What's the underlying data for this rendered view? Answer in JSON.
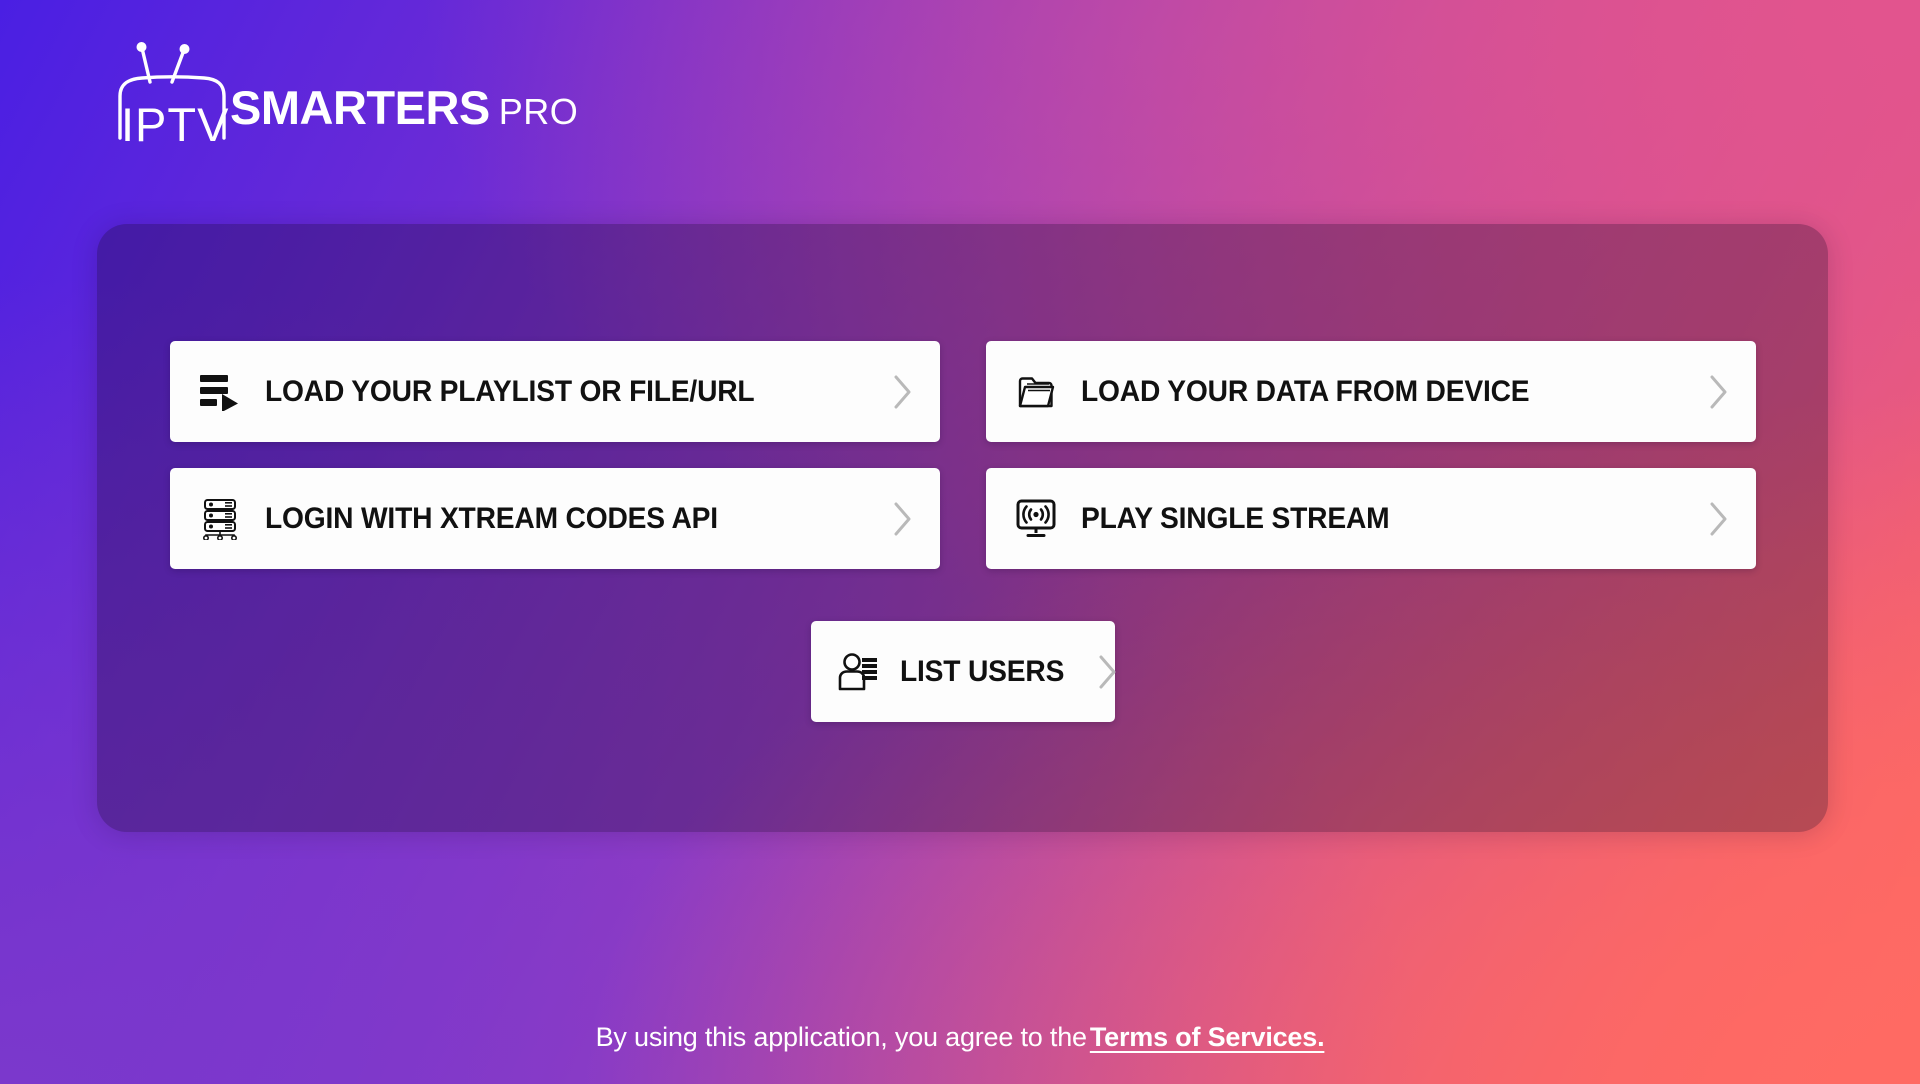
{
  "app": {
    "logo": {
      "icon": "tv-outline-icon",
      "text_light": "IPTV",
      "text_bold": "SMARTERS",
      "text_suffix": "PRO"
    },
    "background": {
      "top_left": "#4A1FE3",
      "top_right": "#D9558A",
      "bottom_left": "#7439C4",
      "bottom_right": "#FC6566"
    },
    "panel": {
      "overlay_color": "rgba(22,6,40,0.30)"
    }
  },
  "menu": {
    "tiles": [
      {
        "id": "load-playlist",
        "label": "LOAD YOUR PLAYLIST OR FILE/URL",
        "icon": "playlist-play-icon",
        "chevron": "chevron-right-icon"
      },
      {
        "id": "load-device",
        "label": "LOAD YOUR DATA FROM DEVICE",
        "icon": "open-folder-icon",
        "chevron": "chevron-right-icon"
      },
      {
        "id": "xtream-login",
        "label": "LOGIN WITH XTREAM CODES API",
        "icon": "server-rack-icon",
        "chevron": "chevron-right-icon"
      },
      {
        "id": "single-stream",
        "label": "PLAY SINGLE STREAM",
        "icon": "monitor-cast-icon",
        "chevron": "chevron-right-icon"
      },
      {
        "id": "list-users",
        "label": "LIST USERS",
        "icon": "user-list-icon",
        "chevron": "chevron-right-icon"
      }
    ]
  },
  "footer": {
    "text": "By using this application, you agree to the",
    "link": "Terms of Services."
  }
}
